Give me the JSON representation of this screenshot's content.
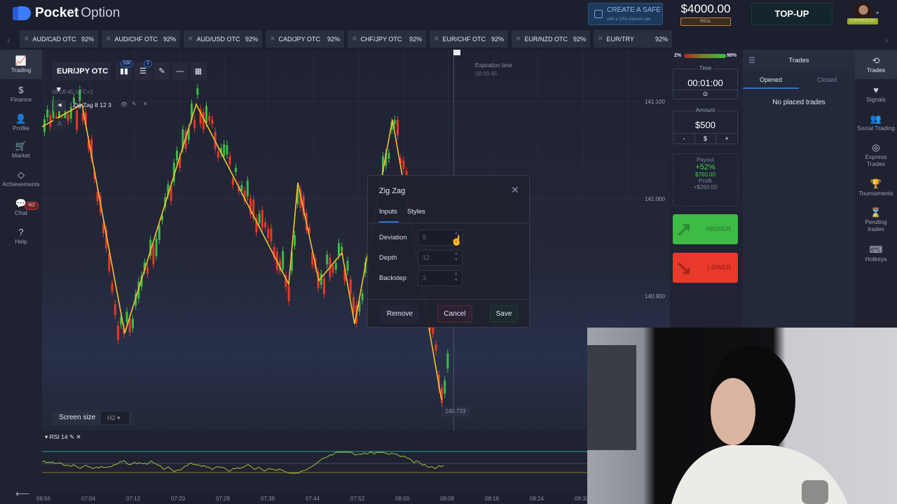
{
  "header": {
    "brand_bold": "Pocket",
    "brand_light": "Option",
    "safe_title": "CREATE A SAFE",
    "safe_sub": "with a 10% interest rate",
    "balance": "$4000.00",
    "account_type": "REAL",
    "topup_label": "TOP-UP",
    "user_badge": "EXPERIENCED"
  },
  "asset_tabs": [
    {
      "name": "AUD/CAD OTC",
      "payout": "92%"
    },
    {
      "name": "AUD/CHF OTC",
      "payout": "92%"
    },
    {
      "name": "AUD/USD OTC",
      "payout": "92%"
    },
    {
      "name": "CAD/JPY OTC",
      "payout": "92%"
    },
    {
      "name": "CHF/JPY OTC",
      "payout": "92%"
    },
    {
      "name": "EUR/CHF OTC",
      "payout": "92%"
    },
    {
      "name": "EUR/NZD OTC",
      "payout": "92%"
    },
    {
      "name": "EUR/TRY",
      "payout": "92%"
    }
  ],
  "left_nav": [
    {
      "label": "Trading",
      "icon": "chart-line-icon",
      "active": true
    },
    {
      "label": "Finance",
      "icon": "dollar-icon"
    },
    {
      "label": "Profile",
      "icon": "user-icon"
    },
    {
      "label": "Market",
      "icon": "cart-icon"
    },
    {
      "label": "Achievements",
      "icon": "diamond-icon"
    },
    {
      "label": "Chat",
      "icon": "chat-icon",
      "badge": "2"
    },
    {
      "label": "Help",
      "icon": "help-icon"
    }
  ],
  "chart": {
    "asset": "EUR/JPY OTC",
    "candles_badge": "S30",
    "indicators_badge": "2",
    "time_readout": "08:08:45 UTC+2",
    "indicator_label": "Zig Zag 8 12 3",
    "expiration_label": "Expiration time",
    "expiration_time": "08:09:45",
    "price_levels": [
      "141.100",
      "141.000",
      "140.900"
    ],
    "current_price": "140.733",
    "screen_size_label": "Screen size",
    "screen_size_value": "H2",
    "rsi_label": "RSI 14",
    "time_ticks": [
      "06:56",
      "07:04",
      "07:12",
      "07:20",
      "07:28",
      "07:36",
      "07:44",
      "07:52",
      "08:00",
      "08:08",
      "08:16",
      "08:24",
      "08:32"
    ],
    "zigzag_color": "#f2c230",
    "up_color": "#3dbb45",
    "down_color": "#e8392a"
  },
  "dialog": {
    "title": "Zig Zag",
    "tabs": [
      "Inputs",
      "Styles"
    ],
    "fields": [
      {
        "label": "Deviation",
        "value": "8"
      },
      {
        "label": "Depth",
        "value": "12"
      },
      {
        "label": "Backstep",
        "value": "3"
      }
    ],
    "remove_label": "Remove",
    "cancel_label": "Cancel",
    "save_label": "Save"
  },
  "trade_panel": {
    "sentiment_low": "2%",
    "sentiment_high": "98%",
    "sentiment_up_fraction": 0.98,
    "time_label": "Time",
    "time_value": "00:01:00",
    "amount_label": "Amount",
    "amount_value": "$500",
    "amount_minus": "-",
    "amount_currency": "$",
    "amount_plus": "+",
    "payout_label": "Payout",
    "payout_pct": "+52%",
    "payout_amount": "$760.00",
    "profit_label": "Profit",
    "profit_amount": "+$260.00",
    "higher_label": "HIGHER",
    "lower_label": "LOWER"
  },
  "trades_panel": {
    "title": "Trades",
    "tab_opened": "Opened",
    "tab_closed": "Closed",
    "empty_text": "No placed trades"
  },
  "right_nav": [
    {
      "label": "Trades",
      "icon": "history-icon",
      "active": true
    },
    {
      "label": "Signals",
      "icon": "heart-pulse-icon"
    },
    {
      "label": "Social Trading",
      "icon": "users-icon"
    },
    {
      "label": "Express Trades",
      "icon": "target-icon"
    },
    {
      "label": "Tournaments",
      "icon": "trophy-icon"
    },
    {
      "label": "Pending trades",
      "icon": "hourglass-icon"
    },
    {
      "label": "Hotkeys",
      "icon": "keyboard-icon"
    }
  ]
}
